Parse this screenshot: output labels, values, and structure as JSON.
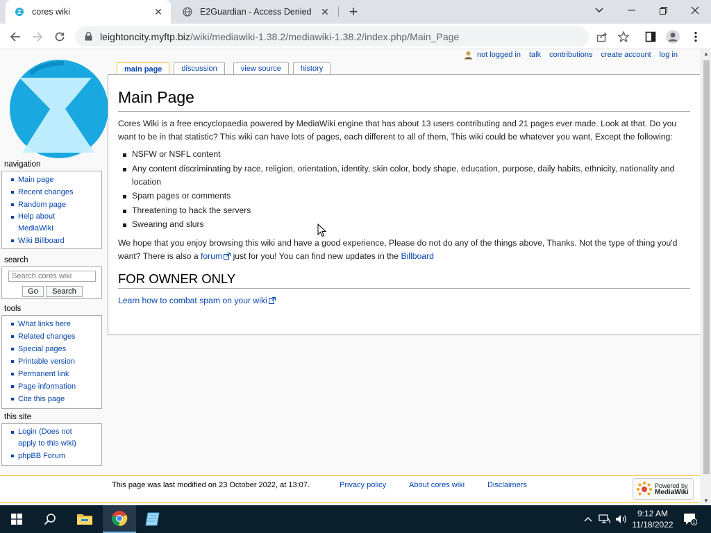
{
  "browser": {
    "tabs": [
      {
        "title": "cores wiki",
        "active": true
      },
      {
        "title": "E2Guardian - Access Denied",
        "active": false
      }
    ],
    "url_host": "leightoncity.myftp.biz",
    "url_path": "/wiki/mediawiki-1.38.2/mediawiki-1.38.2/index.php/Main_Page",
    "icons": [
      "back-icon",
      "forward-icon",
      "reload-icon",
      "lock-icon",
      "share-icon",
      "star-icon",
      "sidepanel-icon",
      "profile-icon",
      "menu-icon",
      "minimize-icon",
      "maximize-icon",
      "close-icon",
      "tab-search-icon"
    ]
  },
  "wiki": {
    "personal": {
      "not_logged_in": "not logged in",
      "talk": "talk",
      "contributions": "contributions",
      "create_account": "create account",
      "log_in": "log in"
    },
    "tabs": {
      "main_page": "main page",
      "discussion": "discussion",
      "view_source": "view source",
      "history": "history"
    },
    "title": "Main Page",
    "intro": "Cores Wiki is a free encyclopaedia powered by MediaWiki engine that has about 13 users contributing and 21 pages ever made. Look at that. Do you want to be in that statistic? This wiki can have lots of pages, each different to all of them, This wiki could be whatever you want, Except the following:",
    "rules": [
      "NSFW or NSFL content",
      "Any content discriminating by race, religion, orientation, identity, skin color, body shape, education, purpose, daily habits, ethnicity, nationality and location",
      "Spam pages or comments",
      "Threatening to hack the servers",
      "Swearing and slurs"
    ],
    "outro_1": "We hope that you enjoy browsing this wiki and have a good experience, Please do not do any of the things above, Thanks. Not the type of thing you'd want? There is also a",
    "forum_link": "forum",
    "outro_2": "just for you! You can find new updates in the",
    "billboard_link": "Billboard",
    "section_heading": "FOR OWNER ONLY",
    "spam_link": "Learn how to combat spam on your wiki",
    "sidebar": {
      "navigation_title": "navigation",
      "navigation": [
        "Main page",
        "Recent changes",
        "Random page",
        "Help about",
        "MediaWiki",
        "Wiki Billboard"
      ],
      "search_title": "search",
      "search_placeholder": "Search cores wiki",
      "go_label": "Go",
      "search_label": "Search",
      "tools_title": "tools",
      "tools": [
        "What links here",
        "Related changes",
        "Special pages",
        "Printable version",
        "Permanent link",
        "Page information",
        "Cite this page"
      ],
      "site_title": "this site",
      "site": [
        "Login (Does not",
        "apply to this wiki)",
        "phpBB Forum"
      ]
    },
    "footer": {
      "last_modified": "This page was last modified on 23 October 2022, at 13:07.",
      "privacy": "Privacy policy",
      "about": "About cores wiki",
      "disclaimers": "Disclaimers",
      "powered_small": "Powered by",
      "powered_big": "MediaWiki"
    }
  },
  "taskbar": {
    "time": "9:12 AM",
    "date": "11/18/2022",
    "notification_count": "1"
  }
}
